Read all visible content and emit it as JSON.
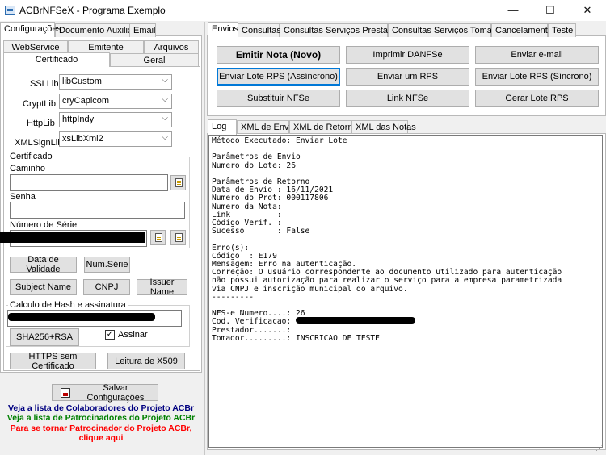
{
  "window": {
    "title": "ACBrNFSeX - Programa Exemplo",
    "controls": {
      "minimize": "—",
      "maximize": "☐",
      "close": "✕"
    }
  },
  "left": {
    "tabs": [
      "Configurações",
      "Documento Auxiliar",
      "Email"
    ],
    "subtabs_row1": [
      "WebService",
      "Emitente",
      "Arquivos"
    ],
    "subtabs_row2": [
      "Certificado",
      "Geral"
    ],
    "ssllib": {
      "label": "SSLLib",
      "value": "libCustom"
    },
    "cryptlib": {
      "label": "CryptLib",
      "value": "cryCapicom"
    },
    "httplib": {
      "label": "HttpLib",
      "value": "httpIndy"
    },
    "xmlsignlib": {
      "label": "XMLSignLib",
      "value": "xsLibXml2"
    },
    "certificado_group": "Certificado",
    "caminho_label": "Caminho",
    "senha_label": "Senha",
    "serie_label": "Número de Série",
    "btn_data_validade": "Data de Validade",
    "btn_num_serie": "Num.Série",
    "btn_subject": "Subject Name",
    "btn_cnpj": "CNPJ",
    "btn_issuer": "Issuer Name",
    "hash_group": "Calculo de Hash e assinatura",
    "btn_sha": "SHA256+RSA",
    "assinar_label": "Assinar",
    "assinar_checked": "✓",
    "btn_https": "HTTPS sem Certificado",
    "btn_x509": "Leitura de X509",
    "btn_salvar": "Salvar Configurações",
    "link_colaboradores": "Veja a lista de Colaboradores do Projeto ACBr",
    "link_patrocinadores": "Veja a lista de Patrocinadores do Projeto ACBr",
    "link_patrocinar_1": "Para se tornar Patrocinador do Projeto ACBr,",
    "link_patrocinar_2": "clique aqui",
    "colors": {
      "colaboradores": "#000080",
      "patrocinadores": "#008000",
      "patrocinar": "#ff0000"
    }
  },
  "right": {
    "tabs": [
      "Envios",
      "Consultas",
      "Consultas Serviços Prestados",
      "Consultas Serviços Tomados",
      "Cancelamento",
      "Teste"
    ],
    "buttons": {
      "emitir": "Emitir Nota (Novo)",
      "imprimir": "Imprimir DANFSe",
      "email": "Enviar e-mail",
      "lote_assinc": "Enviar Lote RPS (Assíncrono)",
      "enviar_rps": "Enviar um RPS",
      "lote_sinc": "Enviar Lote RPS (Síncrono)",
      "substituir": "Substituir NFSe",
      "link": "Link NFSe",
      "gerar_lote": "Gerar Lote RPS"
    },
    "log_tabs": [
      "Log",
      "XML de Envio",
      "XML de Retorno",
      "XML das Notas"
    ],
    "log_lines": [
      "Método Executado: Enviar Lote",
      "",
      "Parâmetros de Envio",
      "Numero do Lote: 26",
      "",
      "Parâmetros de Retorno",
      "Data de Envio : 16/11/2021",
      "Numero do Prot: 000117806",
      "Numero da Nota:",
      "Link          :",
      "Código Verif. :",
      "Sucesso       : False",
      "",
      "Erro(s):",
      "Código  : E179",
      "Mensagem: Erro na autenticação.",
      "Correção: O usuário correspondente ao documento utilizado para autenticação",
      "não possui autorização para realizar o serviço para a empresa parametrizada",
      "via CNPJ e inscrição municipal do arquivo.",
      "---------",
      "",
      "NFS-e Numero....: 26",
      "Cod. Verificacao:",
      "Prestador.......:",
      "Tomador.........: INSCRICAO DE TESTE"
    ]
  }
}
